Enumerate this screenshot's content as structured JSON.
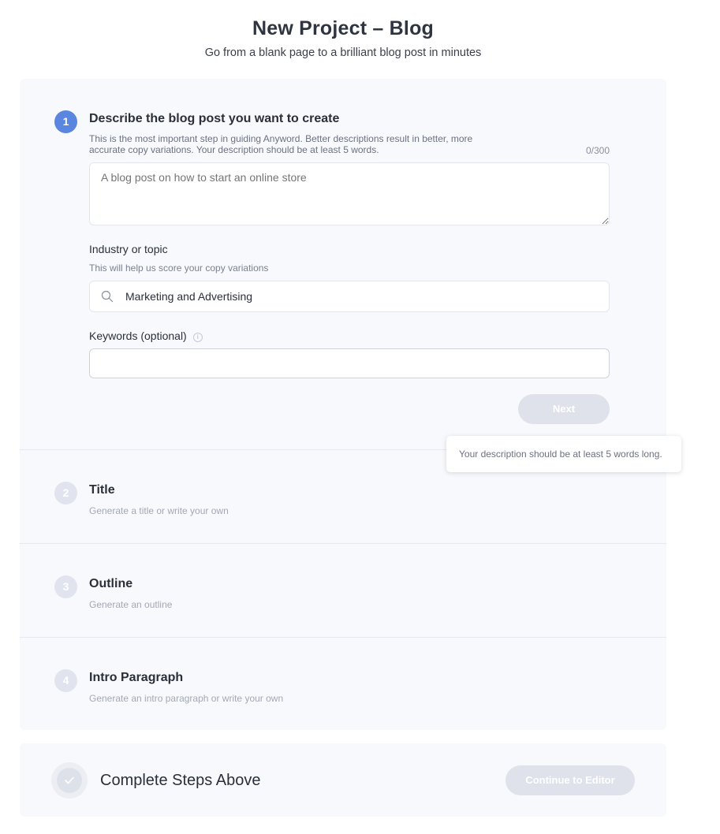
{
  "header": {
    "title": "New Project – Blog",
    "subtitle": "Go from a blank page to a brilliant blog post in minutes"
  },
  "step1": {
    "number": "1",
    "title": "Describe the blog post you want to create",
    "help": "This is the most important step in guiding Anyword. Better descriptions result in better, more accurate copy variations. Your description should be at least 5 words.",
    "counter": "0/300",
    "description_placeholder": "A blog post on how to start an online store",
    "industry_label": "Industry or topic",
    "industry_help": "This will help us score your copy variations",
    "industry_value": "Marketing and Advertising",
    "keywords_label": "Keywords (optional)",
    "keywords_value": "",
    "next_label": "Next"
  },
  "tooltip": "Your description should be at least 5 words long.",
  "steps": [
    {
      "number": "2",
      "title": "Title",
      "subtitle": "Generate a title or write your own"
    },
    {
      "number": "3",
      "title": "Outline",
      "subtitle": "Generate an outline"
    },
    {
      "number": "4",
      "title": "Intro Paragraph",
      "subtitle": "Generate an intro paragraph or write your own"
    }
  ],
  "complete": {
    "title": "Complete Steps Above",
    "continue_label": "Continue to Editor"
  },
  "colors": {
    "accent": "#5b86e0",
    "card_background": "#f8f9fc",
    "disabled_button": "#dfe2ea"
  },
  "icons": [
    "search-icon",
    "info-icon",
    "check-icon"
  ]
}
